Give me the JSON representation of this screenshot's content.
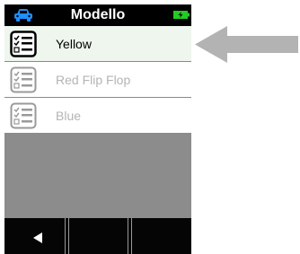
{
  "header": {
    "title": "Modello",
    "car_icon": "car-icon",
    "battery_icon": "battery-charging-icon"
  },
  "list": {
    "items": [
      {
        "label": "Yellow",
        "icon": "checklist-icon",
        "selected": true,
        "enabled": true
      },
      {
        "label": "Red Flip Flop",
        "icon": "checklist-icon",
        "selected": false,
        "enabled": false
      },
      {
        "label": "Blue",
        "icon": "checklist-icon",
        "selected": false,
        "enabled": false
      }
    ]
  },
  "footer": {
    "keys": [
      {
        "icon": "back-arrow-icon"
      },
      {
        "icon": ""
      },
      {
        "icon": ""
      }
    ]
  },
  "annotation": {
    "icon": "pointer-arrow-icon"
  },
  "colors": {
    "header_bg": "#000000",
    "accent_blue": "#1e90ff",
    "battery_green": "#22cc22",
    "selected_row": "#eef6ee",
    "panel_gray": "#8c8c8c",
    "arrow_gray": "#b3b3b3"
  }
}
